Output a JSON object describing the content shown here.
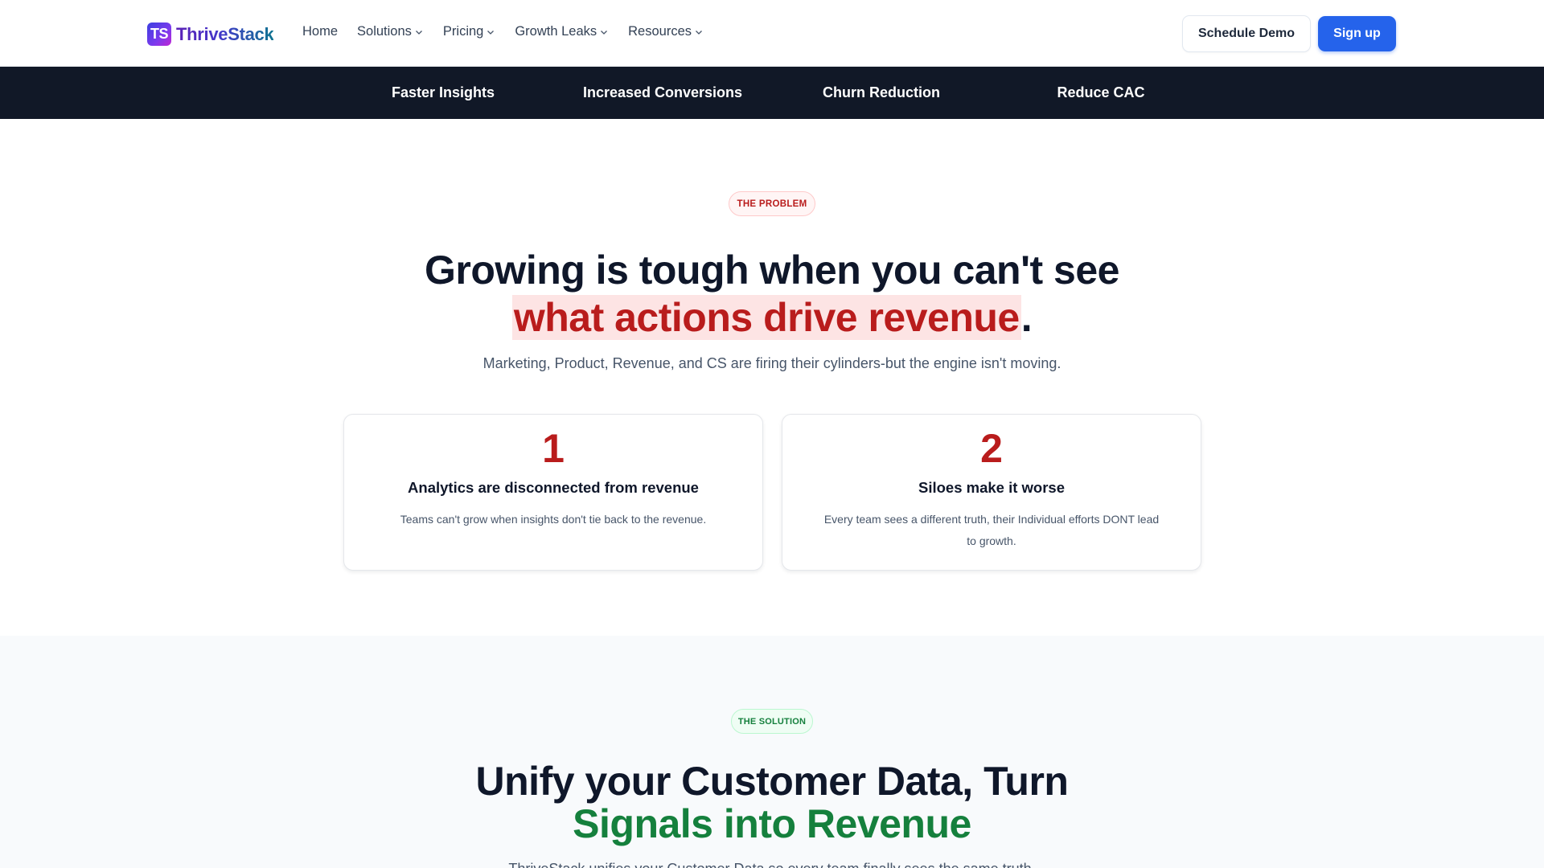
{
  "header": {
    "logo_mark": "TS",
    "logo_text": "ThriveStack",
    "nav": [
      {
        "label": "Home",
        "has_dropdown": false
      },
      {
        "label": "Solutions",
        "has_dropdown": true
      },
      {
        "label": "Pricing",
        "has_dropdown": true
      },
      {
        "label": "Growth Leaks",
        "has_dropdown": true
      },
      {
        "label": "Resources",
        "has_dropdown": true
      }
    ],
    "schedule_demo_label": "Schedule Demo",
    "signup_label": "Sign up"
  },
  "banner": {
    "items": [
      "Faster Insights",
      "Increased Conversions",
      "Churn Reduction",
      "Reduce CAC"
    ]
  },
  "problem": {
    "badge": "THE PROBLEM",
    "heading_line1": "Growing is tough when you can't see",
    "heading_highlight": "what actions drive revenue",
    "heading_end": ".",
    "subtitle": "Marketing, Product, Revenue, and CS are firing their cylinders-but the engine isn't moving.",
    "cards": [
      {
        "number": "1",
        "title": "Analytics are disconnected from revenue",
        "text": "Teams can't grow when insights don't tie back to the revenue."
      },
      {
        "number": "2",
        "title": "Siloes make it worse",
        "text": "Every team sees a different truth, their Individual efforts DONT lead to growth."
      }
    ]
  },
  "solution": {
    "badge": "THE SOLUTION",
    "heading_line1": "Unify your Customer Data, Turn",
    "heading_line2": "Signals into Revenue",
    "subtitle": "ThriveStack unifies your Customer Data so every team finally sees the same truth."
  },
  "colors": {
    "primary_blue": "#2563eb",
    "banner_dark": "#111827",
    "problem_red": "#b91c1c",
    "solution_green": "#15803d"
  }
}
